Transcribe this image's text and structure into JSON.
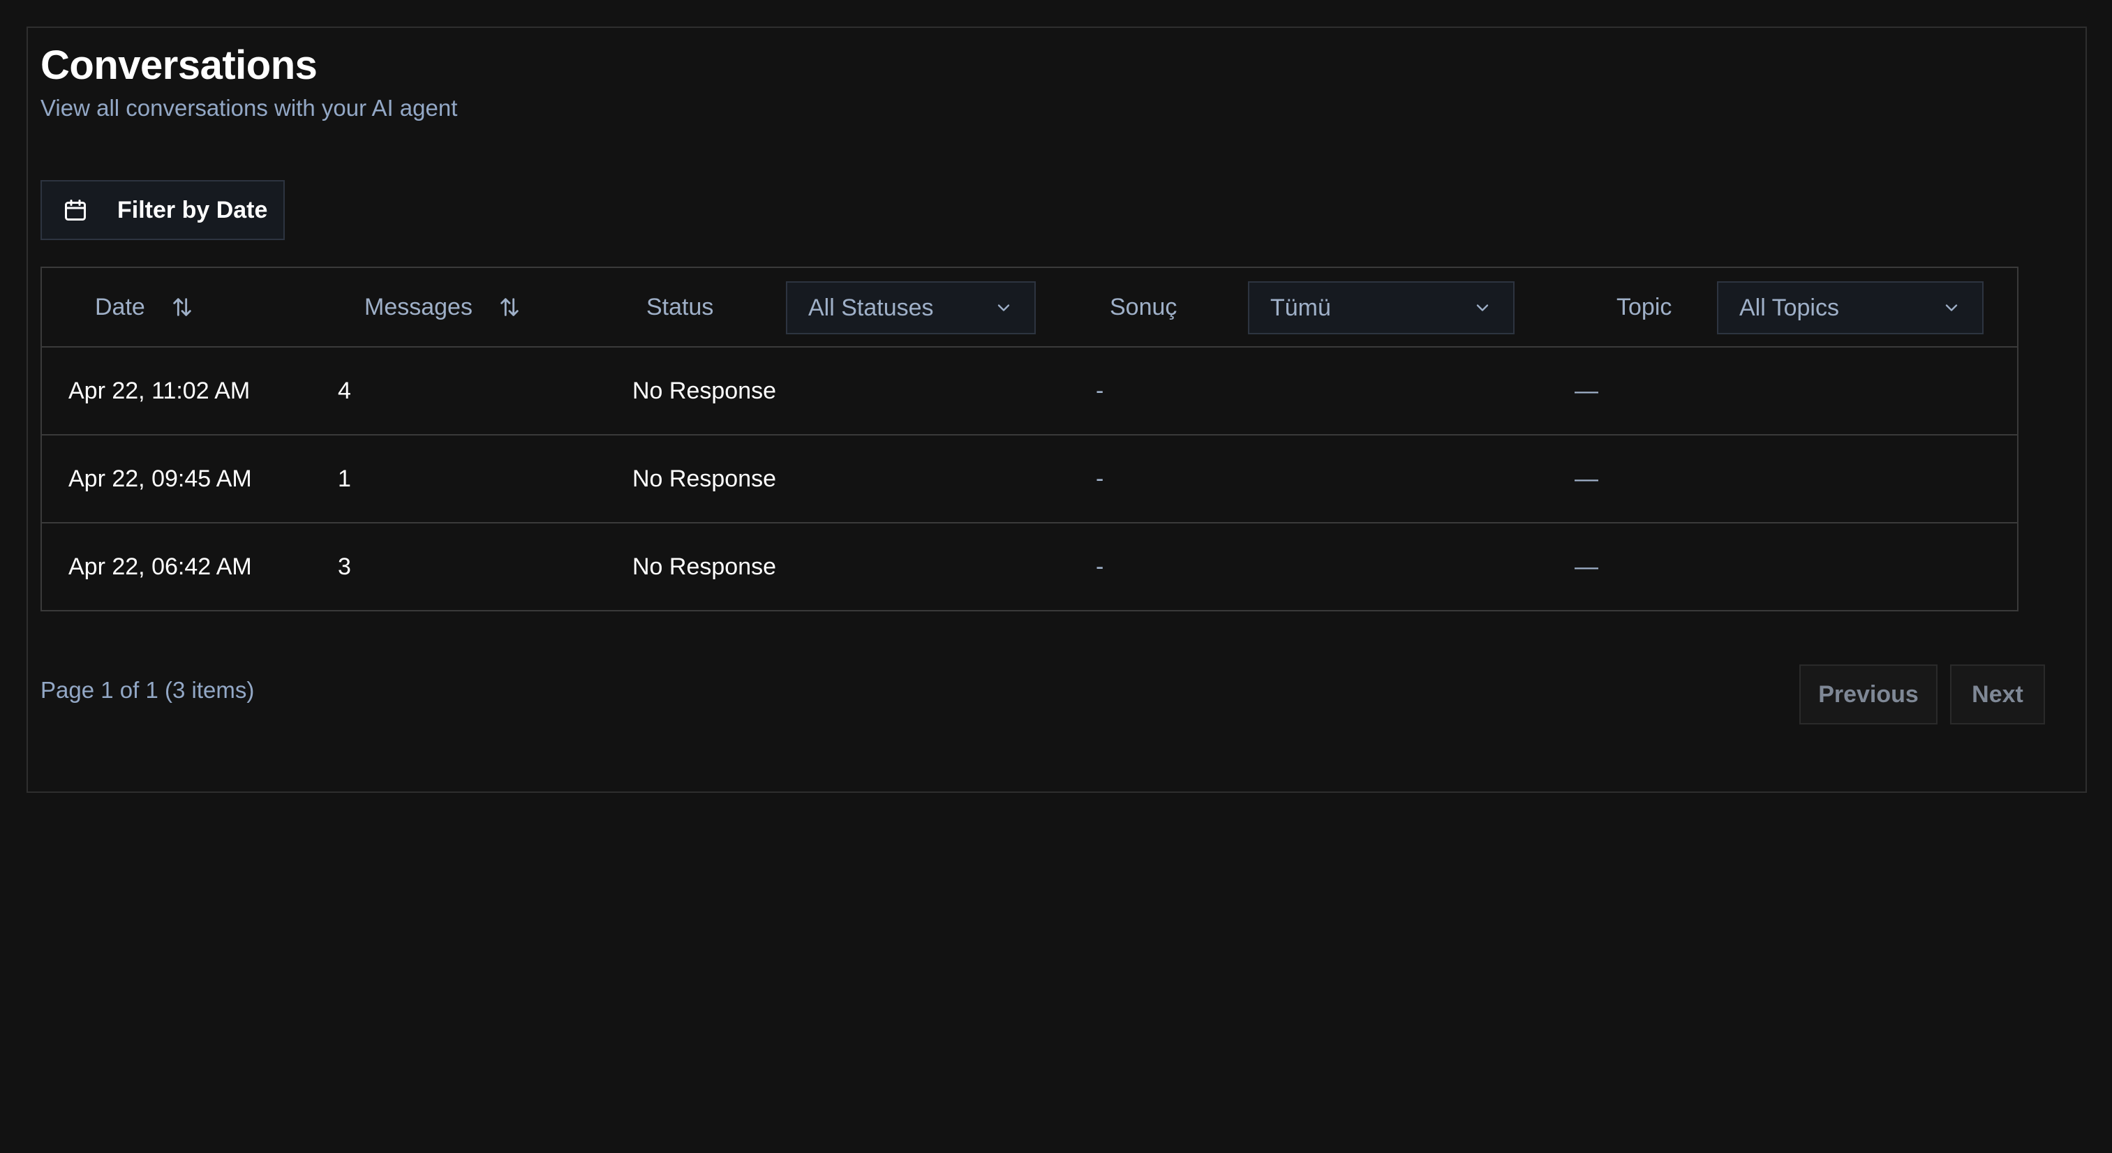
{
  "header": {
    "title": "Conversations",
    "subtitle": "View all conversations with your AI agent"
  },
  "filter": {
    "label": "Filter by Date",
    "icon": "calendar-icon"
  },
  "table": {
    "columns": {
      "date": "Date",
      "messages": "Messages",
      "status": "Status",
      "result": "Sonuç",
      "topic": "Topic"
    },
    "filters": {
      "status": "All Statuses",
      "result": "Tümü",
      "topic": "All Topics"
    },
    "rows": [
      {
        "date": "Apr 22, 11:02 AM",
        "messages": "4",
        "status": "No Response",
        "result": "-",
        "topic": "—"
      },
      {
        "date": "Apr 22, 09:45 AM",
        "messages": "1",
        "status": "No Response",
        "result": "-",
        "topic": "—"
      },
      {
        "date": "Apr 22, 06:42 AM",
        "messages": "3",
        "status": "No Response",
        "result": "-",
        "topic": "—"
      }
    ]
  },
  "pagination": {
    "info": "Page 1 of 1 (3 items)",
    "previous": "Previous",
    "next": "Next"
  },
  "colors": {
    "background": "#121212",
    "muted_text": "#9fb0c8",
    "border": "#3a3a3a"
  }
}
